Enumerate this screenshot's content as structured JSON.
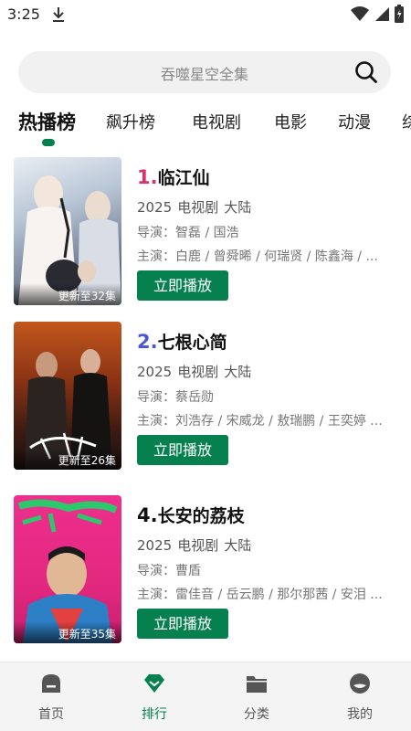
{
  "status": {
    "time": "3:25"
  },
  "search": {
    "placeholder": "吞噬星空全集"
  },
  "tabs": [
    {
      "label": "热播榜",
      "active": true
    },
    {
      "label": "飙升榜"
    },
    {
      "label": "电视剧"
    },
    {
      "label": "电影"
    },
    {
      "label": "动漫"
    },
    {
      "label": "综"
    }
  ],
  "items": [
    {
      "rank": "1.",
      "rank_color": "#d6336c",
      "title": "临江仙",
      "year": "2025",
      "type": "电视剧",
      "region": "大陆",
      "director": "导演：智磊 / 国浩",
      "cast": "主演：白鹿 / 曾舜晞 / 何瑞贤 / 陈鑫海 / ...",
      "badge": "更新至32集",
      "button": "立即播放"
    },
    {
      "rank": "2.",
      "rank_color": "#4b57d8",
      "title": "七根心简",
      "year": "2025",
      "type": "电视剧",
      "region": "大陆",
      "director": "导演：蔡岳勋",
      "cast": "主演：刘浩存 / 宋威龙 / 敖瑞鹏 / 王奕婷 ...",
      "badge": "更新至26集",
      "button": "立即播放"
    },
    {
      "rank": "4.",
      "rank_color": "#111111",
      "title": "长安的荔枝",
      "year": "2025",
      "type": "电视剧",
      "region": "大陆",
      "director": "导演：曹盾",
      "cast": "主演：雷佳音 / 岳云鹏 / 那尔那茜 / 安泪 ...",
      "badge": "更新至35集",
      "button": "立即播放"
    }
  ],
  "bottom_nav": [
    {
      "label": "首页",
      "icon": "home-icon"
    },
    {
      "label": "排行",
      "icon": "ranking-icon",
      "active": true
    },
    {
      "label": "分类",
      "icon": "folder-icon"
    },
    {
      "label": "我的",
      "icon": "profile-icon"
    }
  ],
  "colors": {
    "accent": "#07804f"
  }
}
